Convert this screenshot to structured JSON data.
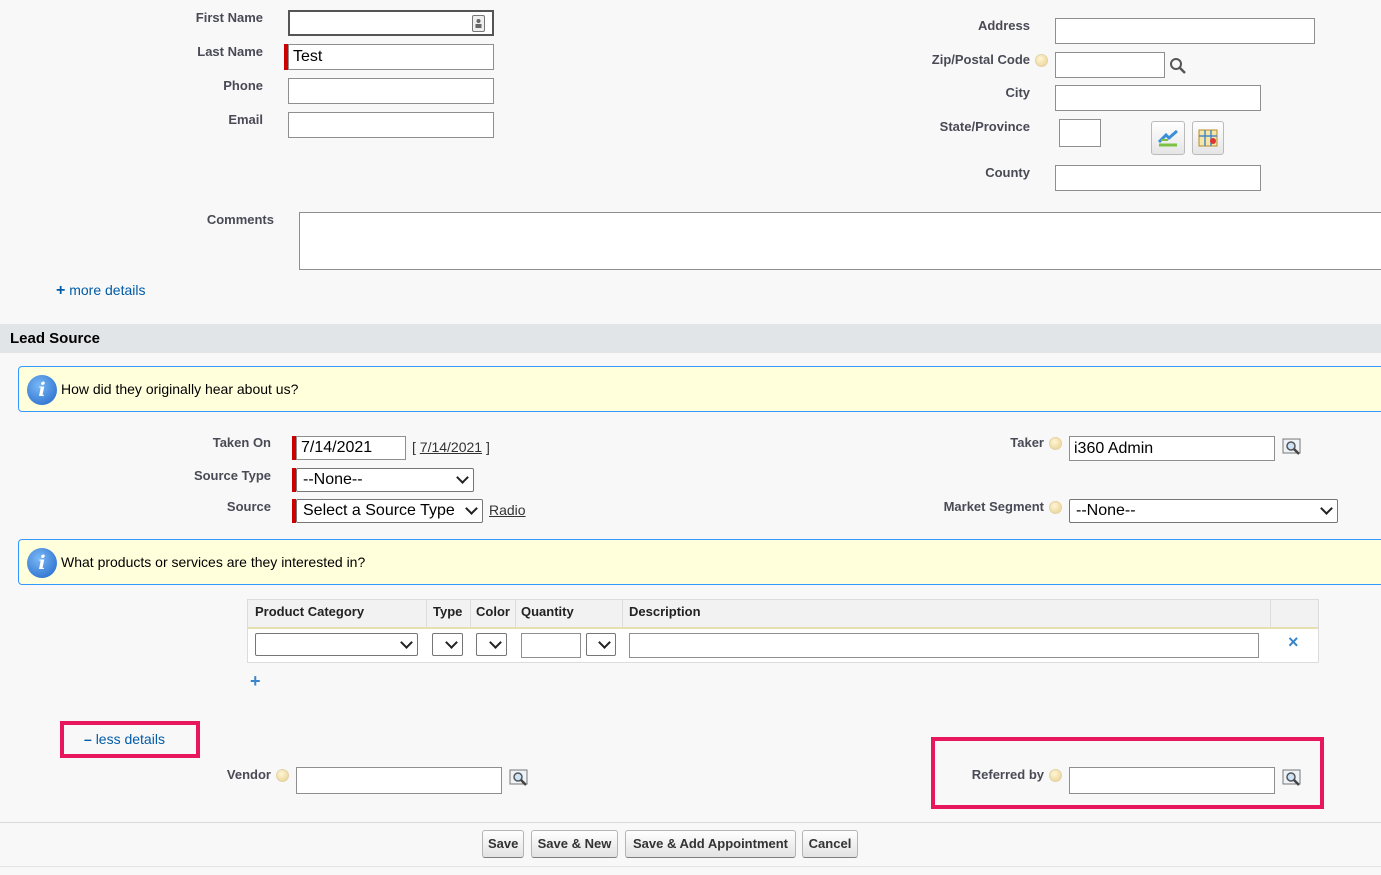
{
  "contact": {
    "first_name_label": "First Name",
    "first_name_value": "",
    "last_name_label": "Last Name",
    "last_name_value": "Test",
    "phone_label": "Phone",
    "phone_value": "",
    "email_label": "Email",
    "email_value": ""
  },
  "address": {
    "address_label": "Address",
    "zip_label": "Zip/Postal Code",
    "city_label": "City",
    "state_label": "State/Province",
    "county_label": "County"
  },
  "comments_label": "Comments",
  "more_details": {
    "sign": "+",
    "label": "more details"
  },
  "lead_source": {
    "section_title": "Lead Source",
    "info1": "How did they originally hear about us?",
    "taken_on_label": "Taken On",
    "taken_on_value": "7/14/2021",
    "taken_on_today_open": "[",
    "taken_on_today_link": "7/14/2021",
    "taken_on_today_close": "]",
    "source_type_label": "Source Type",
    "source_type_value": "--None--",
    "source_label": "Source",
    "source_value": "Select a Source Type",
    "source_link": "Radio",
    "taker_label": "Taker",
    "taker_value": "i360 Admin",
    "market_segment_label": "Market Segment",
    "market_segment_value": "--None--",
    "info2": "What products or services are they interested in?"
  },
  "products_table": {
    "headers": [
      "Product Category",
      "Type",
      "Color",
      "Quantity",
      "Description"
    ],
    "add_sign": "+",
    "remove_sign": "×"
  },
  "less_details": {
    "sign": "–",
    "label": "less details"
  },
  "vendor_label": "Vendor",
  "referred_by_label": "Referred by",
  "buttons": {
    "save": "Save",
    "save_new": "Save & New",
    "save_add_appt": "Save & Add Appointment",
    "cancel": "Cancel"
  },
  "colors": {
    "required": "#cc0000",
    "link": "#015ba7",
    "highlight": "#e8175d",
    "info_bg": "#ffffdc",
    "info_border": "#3399ff",
    "section_bg": "#e1e5e8"
  }
}
